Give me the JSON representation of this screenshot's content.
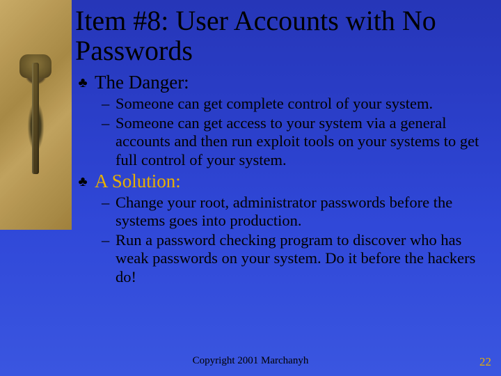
{
  "title": "Item #8: User Accounts with No Passwords",
  "sections": [
    {
      "label": "The Danger:",
      "label_style": "danger",
      "items": [
        "Someone can get complete control of your system.",
        "Someone can get access to your system via a general accounts and then run exploit tools on your systems to get full control of your system."
      ]
    },
    {
      "label": "A Solution:",
      "label_style": "solution",
      "items": [
        "Change your root, administrator passwords before the systems goes into production.",
        "Run a password checking program to discover who has weak passwords on your system. Do it before the hackers do!"
      ]
    }
  ],
  "footer": {
    "copyright": "Copyright 2001 Marchanyh",
    "page": "22"
  },
  "bullet_glyph": "♣",
  "dash_glyph": "–"
}
